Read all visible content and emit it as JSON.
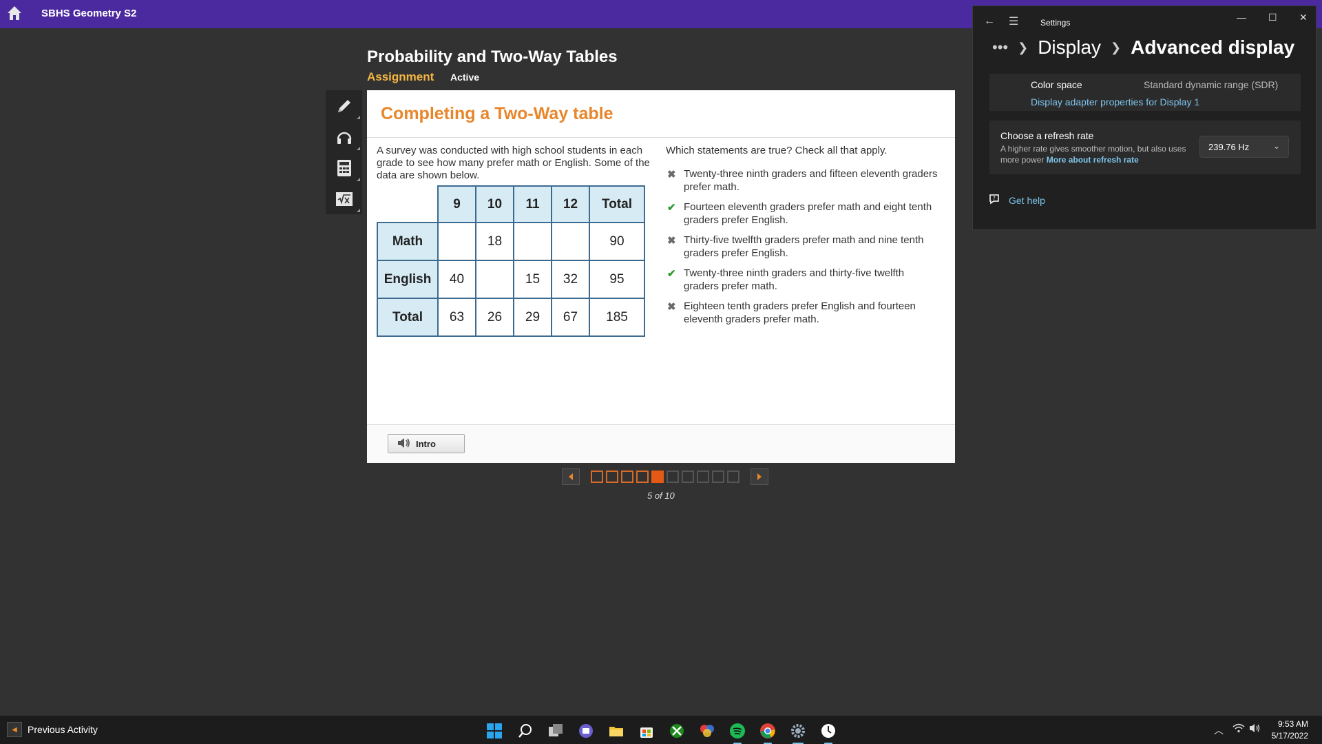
{
  "app": {
    "title": "SBHS Geometry S2"
  },
  "lesson": {
    "title": "Probability and Two-Way Tables",
    "type": "Assignment",
    "status": "Active"
  },
  "tools": [
    "pencil-icon",
    "headphones-icon",
    "calculator-icon",
    "formula-icon"
  ],
  "card": {
    "title": "Completing a Two-Way table",
    "prompt": "A survey was conducted with high school students in each grade to see how many prefer math or English. Some of the data are shown below.",
    "question": "Which statements are true? Check all that apply.",
    "table": {
      "headers": [
        "9",
        "10",
        "11",
        "12",
        "Total"
      ],
      "rows": [
        {
          "label": "Math",
          "cells": [
            "",
            "18",
            "",
            "",
            "90"
          ]
        },
        {
          "label": "English",
          "cells": [
            "40",
            "",
            "15",
            "32",
            "95"
          ]
        },
        {
          "label": "Total",
          "cells": [
            "63",
            "26",
            "29",
            "67",
            "185"
          ]
        }
      ]
    },
    "options": [
      {
        "text": "Twenty-three ninth graders and fifteen eleventh graders prefer math.",
        "result": "incorrect"
      },
      {
        "text": "Fourteen eleventh graders prefer math and eight tenth graders prefer English.",
        "result": "correct"
      },
      {
        "text": "Thirty-five twelfth graders prefer math and nine tenth graders prefer English.",
        "result": "incorrect"
      },
      {
        "text": "Twenty-three ninth graders and thirty-five twelfth graders prefer math.",
        "result": "correct"
      },
      {
        "text": "Eighteen tenth graders prefer English and fourteen eleventh graders prefer math.",
        "result": "incorrect"
      }
    ],
    "intro_label": "Intro"
  },
  "pager": {
    "current": 5,
    "total": 10,
    "text": "5 of 10"
  },
  "settings": {
    "window_title": "Settings",
    "breadcrumb": [
      "Display",
      "Advanced display"
    ],
    "color_space_label": "Color space",
    "color_space_value": "Standard dynamic range (SDR)",
    "adapter_link": "Display adapter properties for Display 1",
    "refresh_title": "Choose a refresh rate",
    "refresh_desc": "A higher rate gives smoother motion, but also uses more power",
    "refresh_link": "More about refresh rate",
    "refresh_value": "239.76 Hz",
    "help_label": "Get help"
  },
  "footer": {
    "previous_label": "Previous Activity"
  },
  "taskbar": {
    "apps": [
      "windows-start-icon",
      "search-icon",
      "task-view-icon",
      "teams-icon",
      "file-explorer-icon",
      "store-icon",
      "xbox-icon",
      "color-app-icon",
      "spotify-icon",
      "chrome-icon",
      "settings-icon",
      "clock-app-icon"
    ],
    "time": "9:53 AM",
    "date": "5/17/2022"
  }
}
